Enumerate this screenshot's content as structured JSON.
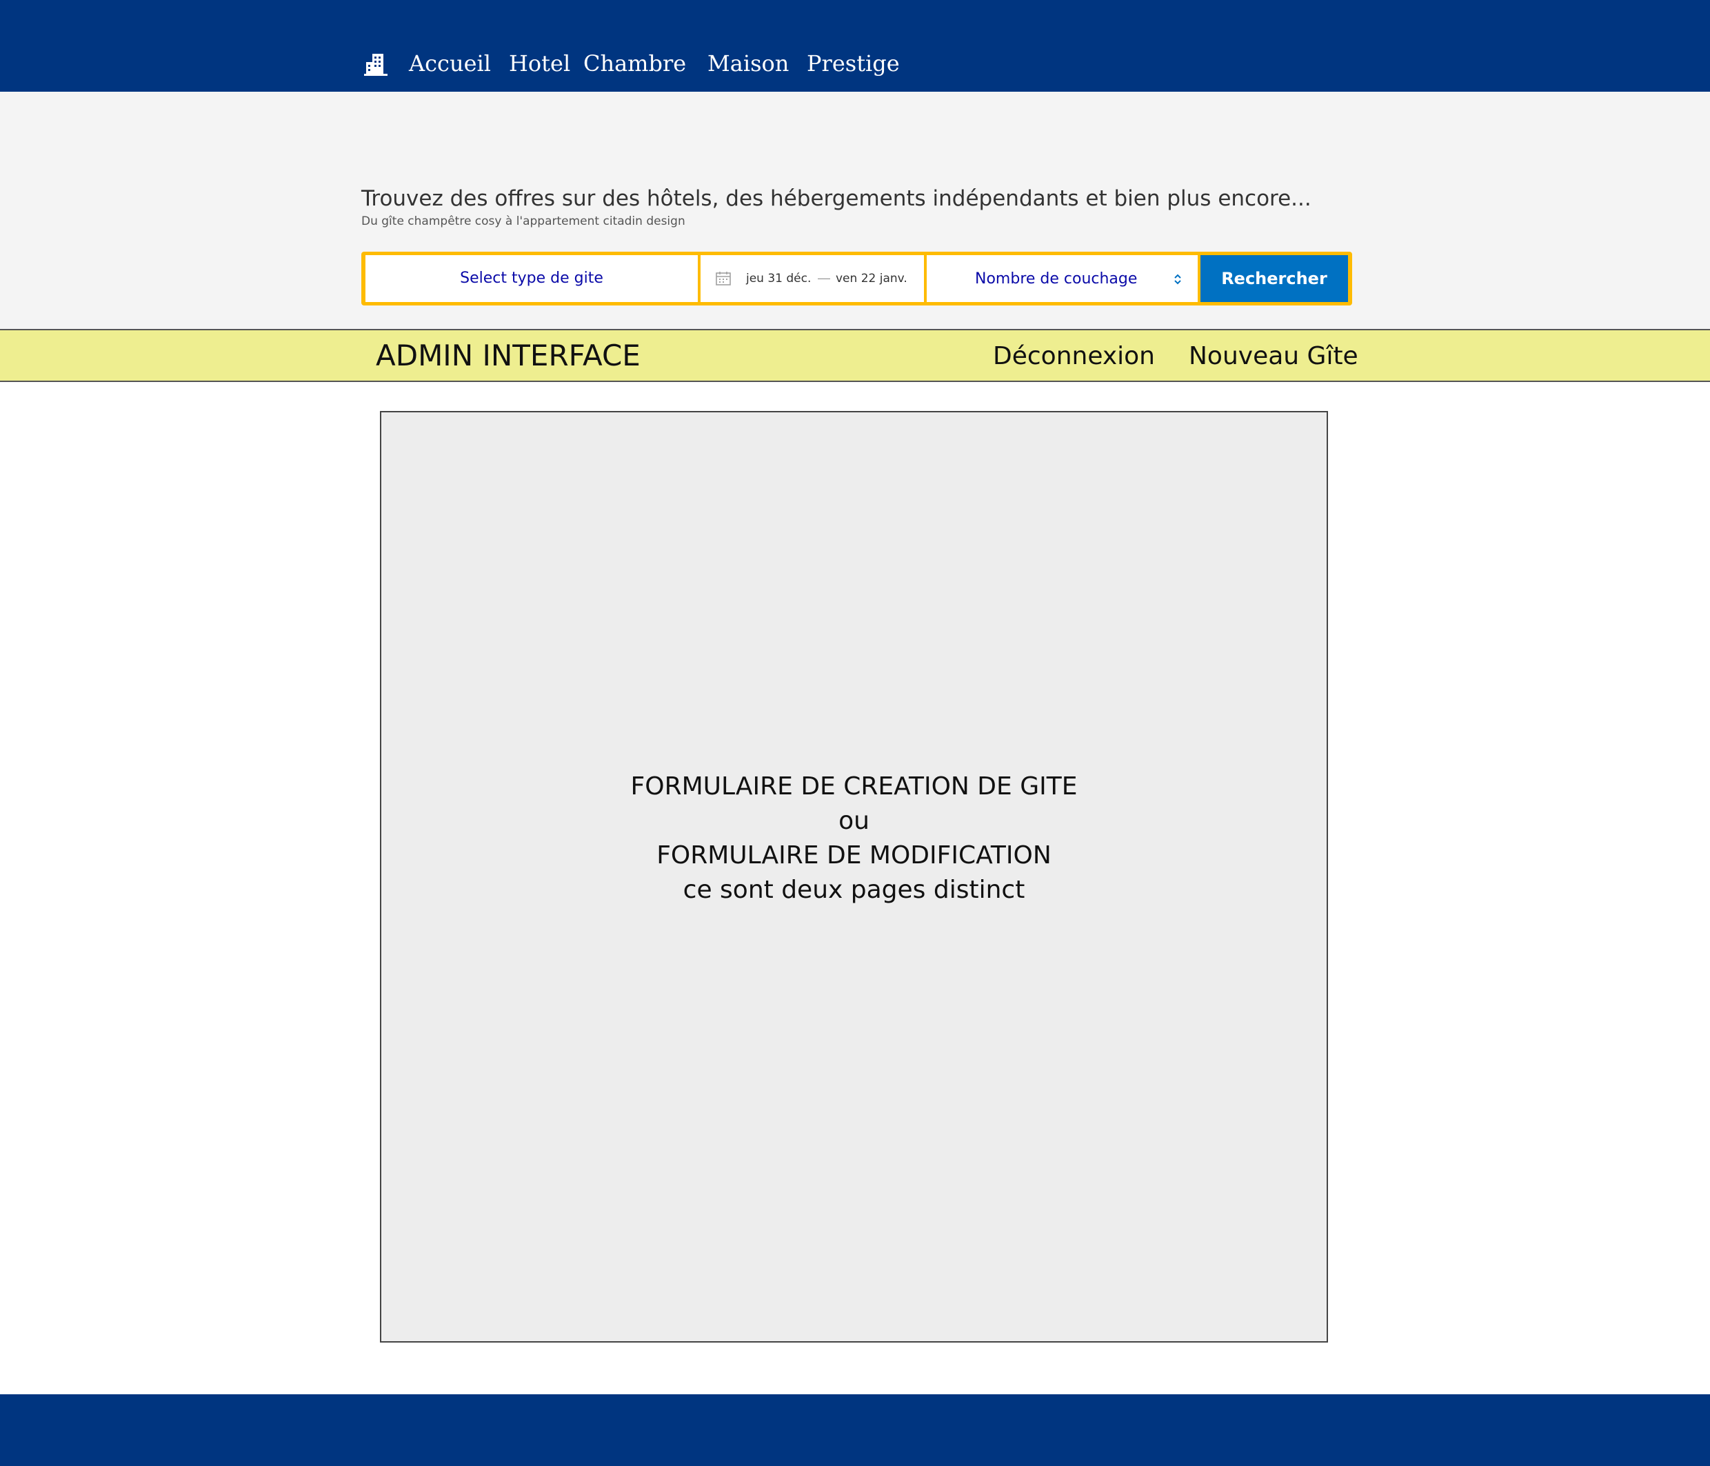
{
  "colors": {
    "nav_background": "#003580",
    "search_border": "#febb02",
    "search_button": "#0071c2",
    "admin_bar": "#eeee90",
    "field_text": "#0a0aa8"
  },
  "nav": {
    "logo_icon": "hotel-building-icon",
    "items": [
      {
        "label": "Accueil"
      },
      {
        "label": "Hotel"
      },
      {
        "label": "Chambre"
      },
      {
        "label": "Maison"
      },
      {
        "label": "Prestige"
      }
    ]
  },
  "hero": {
    "title": "Trouvez des offres sur des hôtels, des hébergements indépendants et bien plus encore...",
    "subtitle": "Du gîte champêtre cosy à l'appartement citadin design"
  },
  "search": {
    "type_select_label": "Select type de gite",
    "calendar_icon": "calendar-icon",
    "date_start": "jeu 31 déc.",
    "date_separator": "—",
    "date_end": "ven 22 janv.",
    "guests_label": "Nombre de couchage",
    "guests_icon": "chevron-updown-icon",
    "button_label": "Rechercher"
  },
  "admin": {
    "title": "ADMIN INTERFACE",
    "logout_label": "Déconnexion",
    "new_label": "Nouveau Gîte"
  },
  "form_placeholder": {
    "line1": "FORMULAIRE DE CREATION DE GITE",
    "line2": "ou",
    "line3": "FORMULAIRE DE MODIFICATION",
    "line4": "ce sont deux pages distinct"
  }
}
